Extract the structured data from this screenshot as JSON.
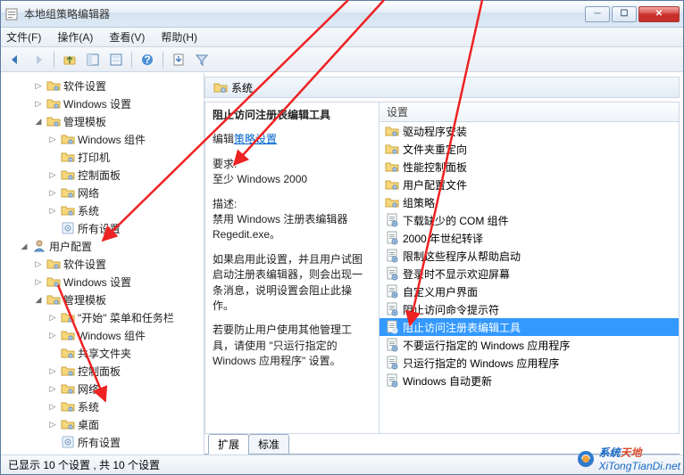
{
  "window": {
    "title": "本地组策略编辑器"
  },
  "menu": {
    "file": "文件(F)",
    "action": "操作(A)",
    "view": "查看(V)",
    "help": "帮助(H)"
  },
  "tree": {
    "items": [
      {
        "depth": 2,
        "icon": "folder",
        "twisty": "right",
        "label": "软件设置"
      },
      {
        "depth": 2,
        "icon": "folder",
        "twisty": "right",
        "label": "Windows 设置"
      },
      {
        "depth": 2,
        "icon": "folder-open",
        "twisty": "down",
        "label": "管理模板"
      },
      {
        "depth": 3,
        "icon": "folder",
        "twisty": "right",
        "label": "Windows 组件"
      },
      {
        "depth": 3,
        "icon": "folder",
        "twisty": "",
        "label": "打印机"
      },
      {
        "depth": 3,
        "icon": "folder",
        "twisty": "right",
        "label": "控制面板"
      },
      {
        "depth": 3,
        "icon": "folder",
        "twisty": "right",
        "label": "网络"
      },
      {
        "depth": 3,
        "icon": "folder",
        "twisty": "right",
        "label": "系统"
      },
      {
        "depth": 3,
        "icon": "settings",
        "twisty": "",
        "label": "所有设置"
      },
      {
        "depth": 1,
        "icon": "user",
        "twisty": "down",
        "label": "用户配置"
      },
      {
        "depth": 2,
        "icon": "folder",
        "twisty": "right",
        "label": "软件设置"
      },
      {
        "depth": 2,
        "icon": "folder",
        "twisty": "right",
        "label": "Windows 设置"
      },
      {
        "depth": 2,
        "icon": "folder-open",
        "twisty": "down",
        "label": "管理模板"
      },
      {
        "depth": 3,
        "icon": "folder",
        "twisty": "right",
        "label": "\"开始\" 菜单和任务栏"
      },
      {
        "depth": 3,
        "icon": "folder",
        "twisty": "right",
        "label": "Windows 组件"
      },
      {
        "depth": 3,
        "icon": "folder",
        "twisty": "",
        "label": "共享文件夹"
      },
      {
        "depth": 3,
        "icon": "folder",
        "twisty": "right",
        "label": "控制面板"
      },
      {
        "depth": 3,
        "icon": "folder",
        "twisty": "right",
        "label": "网络"
      },
      {
        "depth": 3,
        "icon": "folder",
        "twisty": "right",
        "label": "系统"
      },
      {
        "depth": 3,
        "icon": "folder",
        "twisty": "right",
        "label": "桌面"
      },
      {
        "depth": 3,
        "icon": "settings",
        "twisty": "",
        "label": "所有设置"
      }
    ]
  },
  "path": {
    "label": "系统"
  },
  "info": {
    "title": "阻止访问注册表编辑工具",
    "edit_prefix": "编辑",
    "edit_link": "策略设置",
    "req_label": "要求:",
    "req_value": "至少 Windows 2000",
    "desc_label": "描述:",
    "desc1": "禁用 Windows 注册表编辑器 Regedit.exe。",
    "desc2": "如果启用此设置，并且用户试图启动注册表编辑器，则会出现一条消息，说明设置会阻止此操作。",
    "desc3": "若要防止用户使用其他管理工具，请使用 \"只运行指定的 Windows 应用程序\" 设置。"
  },
  "list": {
    "header": "设置",
    "items": [
      {
        "icon": "folder",
        "label": "驱动程序安装",
        "selected": false
      },
      {
        "icon": "folder",
        "label": "文件夹重定向",
        "selected": false
      },
      {
        "icon": "folder",
        "label": "性能控制面板",
        "selected": false
      },
      {
        "icon": "folder",
        "label": "用户配置文件",
        "selected": false
      },
      {
        "icon": "folder",
        "label": "组策略",
        "selected": false
      },
      {
        "icon": "policy",
        "label": "下载缺少的 COM 组件",
        "selected": false
      },
      {
        "icon": "policy",
        "label": "2000 年世纪转译",
        "selected": false
      },
      {
        "icon": "policy",
        "label": "限制这些程序从帮助启动",
        "selected": false
      },
      {
        "icon": "policy",
        "label": "登录时不显示欢迎屏幕",
        "selected": false
      },
      {
        "icon": "policy",
        "label": "自定义用户界面",
        "selected": false
      },
      {
        "icon": "policy",
        "label": "阻止访问命令提示符",
        "selected": false
      },
      {
        "icon": "policy",
        "label": "阻止访问注册表编辑工具",
        "selected": true
      },
      {
        "icon": "policy",
        "label": "不要运行指定的 Windows 应用程序",
        "selected": false
      },
      {
        "icon": "policy",
        "label": "只运行指定的 Windows 应用程序",
        "selected": false
      },
      {
        "icon": "policy",
        "label": "Windows 自动更新",
        "selected": false
      }
    ]
  },
  "tabs": {
    "extended": "扩展",
    "standard": "标准"
  },
  "status": {
    "text": "已显示 10 个设置 , 共 10 个设置"
  },
  "watermark": {
    "a": "系统",
    "b": "天地",
    "url": "XiTongTianDi.net"
  }
}
